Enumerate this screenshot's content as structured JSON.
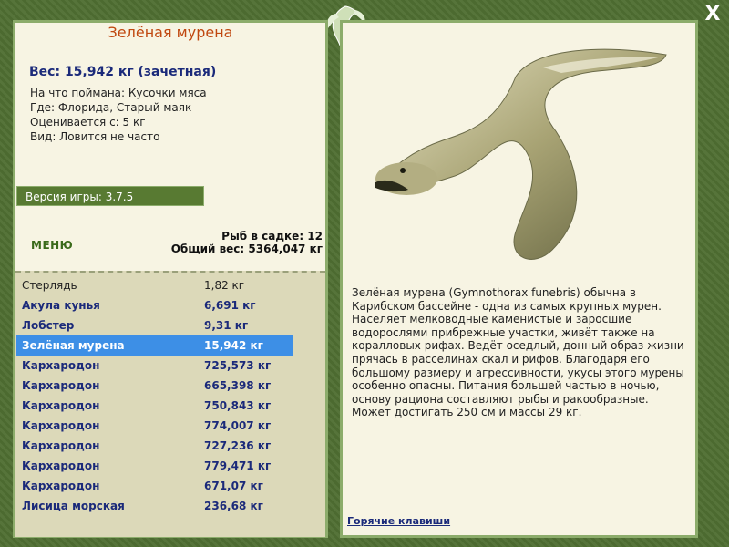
{
  "fish": {
    "name": "Зелёная мурена",
    "weight_line": "Вес: 15,942 кг (зачетная)",
    "caught_with": "На что поймана: Кусочки мяса",
    "location": "Где: Флорида, Старый маяк",
    "valued_from": "Оценивается с: 5 кг",
    "frequency": "Вид: Ловится не часто"
  },
  "version": "Версия игры: 3.7.5",
  "menu_label": "МЕНЮ",
  "stats": {
    "fish_in_cage": "Рыб в садке: 12",
    "total_weight": "Общий вес: 5364,047 кг"
  },
  "catch_list": [
    {
      "name": "Стерлядь",
      "weight": "1,82 кг",
      "style": "plain"
    },
    {
      "name": "Акула кунья",
      "weight": "6,691 кг",
      "style": "bold"
    },
    {
      "name": "Лобстер",
      "weight": "9,31 кг",
      "style": "bold"
    },
    {
      "name": "Зелёная мурена",
      "weight": "15,942 кг",
      "style": "selected"
    },
    {
      "name": "Кархародон",
      "weight": "725,573 кг",
      "style": "bold"
    },
    {
      "name": "Кархародон",
      "weight": "665,398 кг",
      "style": "bold"
    },
    {
      "name": "Кархародон",
      "weight": "750,843 кг",
      "style": "bold"
    },
    {
      "name": "Кархародон",
      "weight": "774,007 кг",
      "style": "bold"
    },
    {
      "name": "Кархародон",
      "weight": "727,236 кг",
      "style": "bold"
    },
    {
      "name": "Кархародон",
      "weight": "779,471 кг",
      "style": "bold"
    },
    {
      "name": "Кархародон",
      "weight": "671,07 кг",
      "style": "bold"
    },
    {
      "name": "Лисица морская",
      "weight": "236,68 кг",
      "style": "bold"
    }
  ],
  "description": "Зелёная мурена (Gymnothorax funebris) обычна в Карибском бассейне - одна из самых крупных мурен. Населяет мелководные каменистые и заросшие водорослями прибрежные участки, живёт также на коралловых рифах. Ведёт оседлый, донный образ жизни прячась в расселинах скал и рифов. Благодаря его большому размеру и агрессивности, укусы этого мурены особенно опасны. Питания большей частью в ночью, основу рациона составляют рыбы и ракообразные. Может достигать 250 см и массы 29 кг.",
  "hotkeys_label": "Горячие клавиши",
  "close_label": "X",
  "colors": {
    "frame": "#4e6b2d",
    "panel": "#f7f4e3",
    "list_bg": "#dcd9b9",
    "selected": "#3d8fe6",
    "name_accent": "#c04810",
    "text_blue": "#1b2a7a"
  },
  "icons": {
    "logo": "fish-logo-icon",
    "close": "close-icon"
  }
}
